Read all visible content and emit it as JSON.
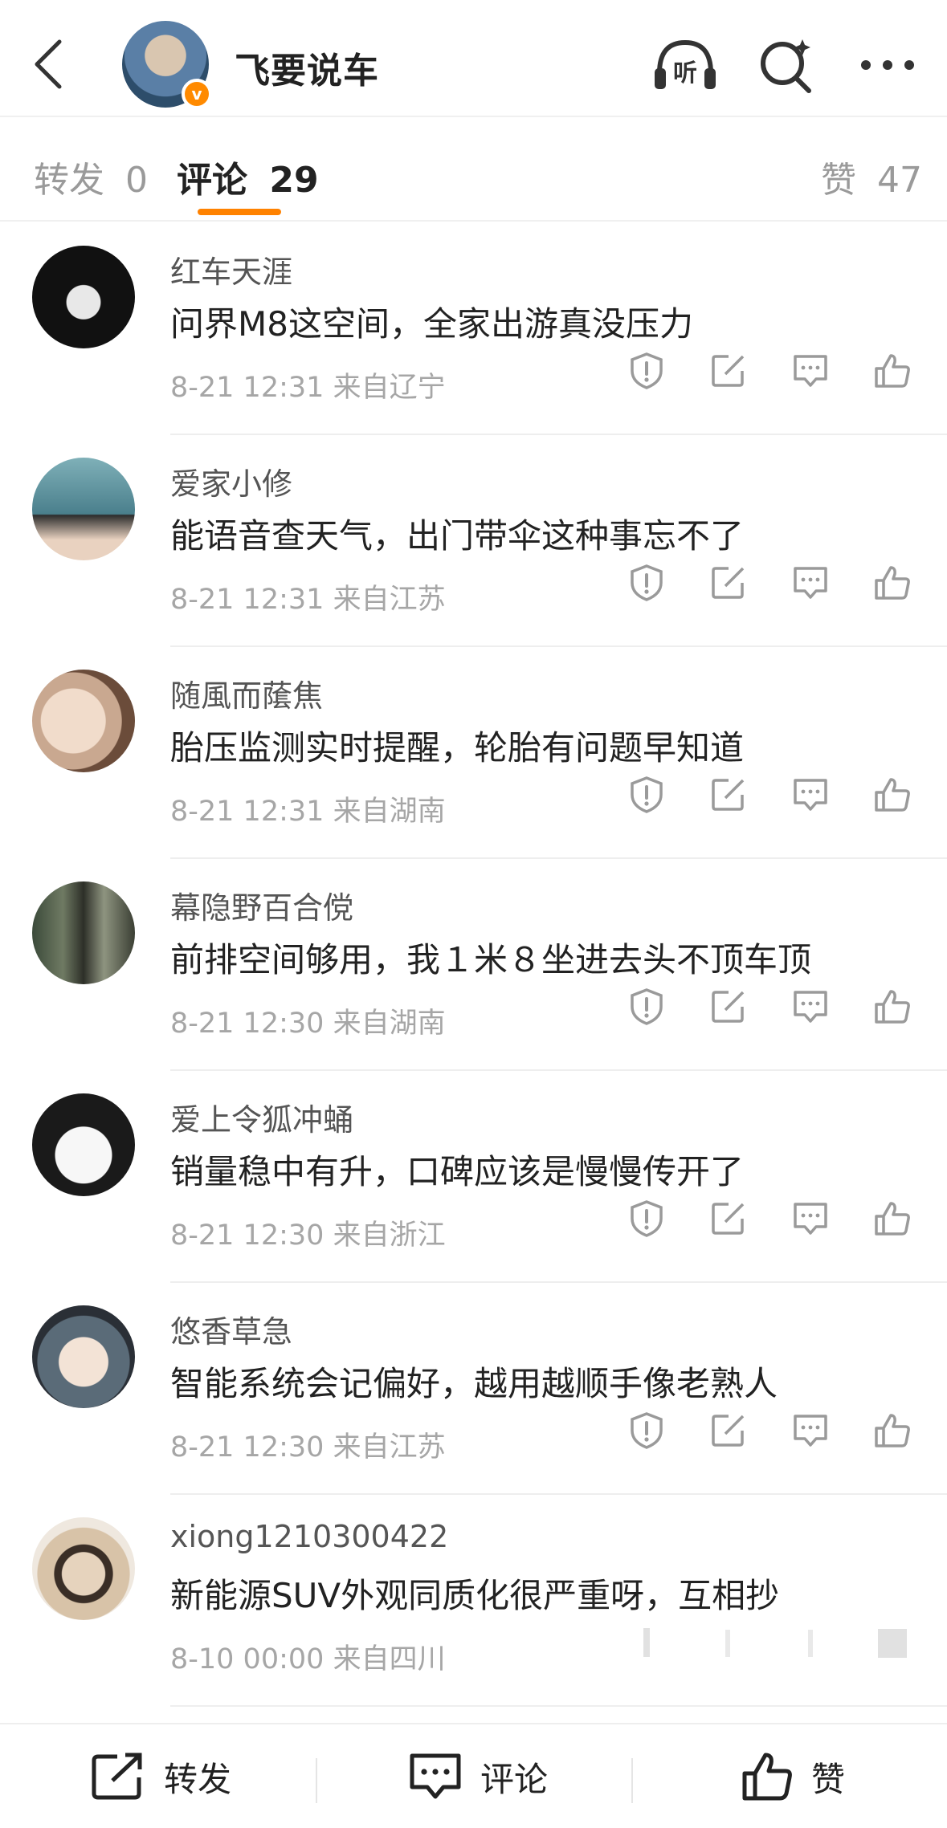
{
  "header": {
    "title": "飞要说车",
    "avatar_badge": "v",
    "listen_label": "听"
  },
  "tabs": [
    {
      "label": "转发",
      "count": "0"
    },
    {
      "label": "评论",
      "count": "29"
    },
    {
      "label": "赞",
      "count": "47"
    }
  ],
  "comments": [
    {
      "name": "红车天涯",
      "text": "问界M8这空间，全家出游真没压力",
      "time": "8-21 12:31",
      "location": "来自辽宁"
    },
    {
      "name": "爱家小修",
      "text": "能语音查天气，出门带伞这种事忘不了",
      "time": "8-21 12:31",
      "location": "来自江苏"
    },
    {
      "name": "随風而䕃焦",
      "text": "胎压监测实时提醒，轮胎有问题早知道",
      "time": "8-21 12:31",
      "location": "来自湖南"
    },
    {
      "name": "幕隐野百合傥",
      "text": "前排空间够用，我１米８坐进去头不顶车顶",
      "time": "8-21 12:30",
      "location": "来自湖南"
    },
    {
      "name": "爱上令狐冲蛹",
      "text": "销量稳中有升，口碑应该是慢慢传开了",
      "time": "8-21 12:30",
      "location": "来自浙江"
    },
    {
      "name": "悠香草急",
      "text": "智能系统会记偏好，越用越顺手像老熟人",
      "time": "8-21 12:30",
      "location": "来自江苏"
    },
    {
      "name": "xiong1210300422",
      "text": "新能源SUV外观同质化很严重呀，互相抄",
      "time": "8-10 00:00",
      "location": "来自四川"
    }
  ],
  "bottom_bar": {
    "repost_label": "转发",
    "comment_label": "评论",
    "like_label": "赞"
  },
  "colors": {
    "accent": "#ff8200",
    "muted_text": "#a6a6a6",
    "icon_gray": "#9a9a9a"
  }
}
